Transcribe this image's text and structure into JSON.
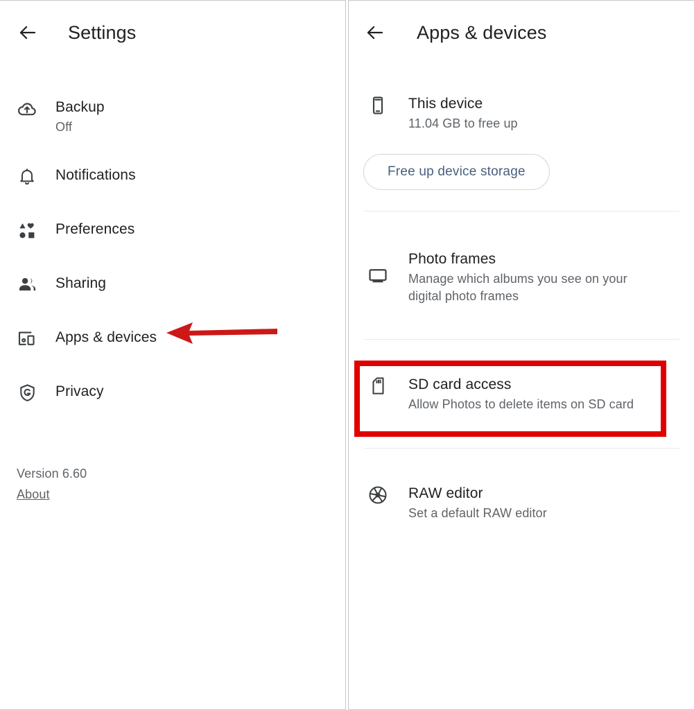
{
  "left_panel": {
    "back_icon": "arrow-back-icon",
    "title": "Settings",
    "items": [
      {
        "icon": "cloud-upload-icon",
        "title": "Backup",
        "subtitle": "Off"
      },
      {
        "icon": "bell-icon",
        "title": "Notifications",
        "subtitle": ""
      },
      {
        "icon": "shapes-icon",
        "title": "Preferences",
        "subtitle": ""
      },
      {
        "icon": "people-icon",
        "title": "Sharing",
        "subtitle": ""
      },
      {
        "icon": "devices-icon",
        "title": "Apps & devices",
        "subtitle": ""
      },
      {
        "icon": "shield-g-icon",
        "title": "Privacy",
        "subtitle": ""
      }
    ],
    "version": "Version 6.60",
    "about_label": "About"
  },
  "right_panel": {
    "back_icon": "arrow-back-icon",
    "title": "Apps & devices",
    "device": {
      "icon": "phone-icon",
      "title": "This device",
      "subtitle": "11.04 GB to free up",
      "button_label": "Free up device storage"
    },
    "items": [
      {
        "icon": "monitor-icon",
        "title": "Photo frames",
        "subtitle_line1": "Manage which albums you see on your",
        "subtitle_line2": "digital photo frames"
      },
      {
        "icon": "sd-card-icon",
        "title": "SD card access",
        "subtitle_line1": "Allow Photos to delete items on SD card",
        "subtitle_line2": ""
      },
      {
        "icon": "aperture-icon",
        "title": "RAW editor",
        "subtitle_line1": "Set a default RAW editor",
        "subtitle_line2": ""
      }
    ]
  },
  "annotations": {
    "highlight_color": "#e00000",
    "arrow_color": "#cc1818",
    "highlight_target": "SD card access",
    "arrow_target": "Apps & devices"
  },
  "colors": {
    "text_primary": "#202124",
    "text_secondary": "#5f6368",
    "button_text": "#4a5e7e",
    "divider": "#e8eaed",
    "panel_border": "#c8c8c8"
  }
}
